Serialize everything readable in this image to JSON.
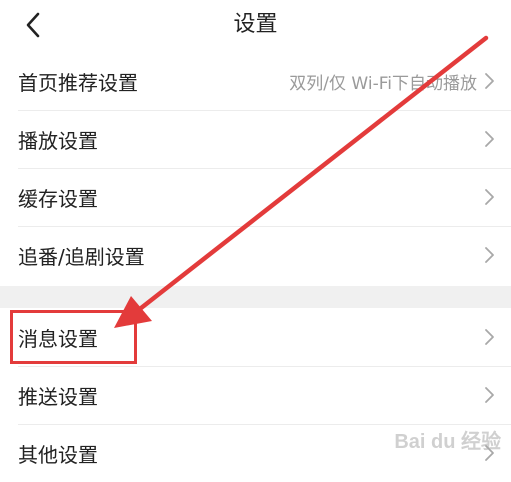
{
  "header": {
    "title": "设置",
    "back_icon": "chevron-left-icon"
  },
  "settings": [
    {
      "label": "首页推荐设置",
      "value": "双列/仅 Wi-Fi下自动播放"
    },
    {
      "label": "播放设置"
    },
    {
      "label": "缓存设置"
    },
    {
      "label": "追番/追剧设置"
    }
  ],
  "settings2": [
    {
      "label": "消息设置",
      "highlighted": true
    },
    {
      "label": "推送设置"
    },
    {
      "label": "其他设置"
    }
  ],
  "annotation": {
    "color": "#e33b3b",
    "arrow_target": "消息设置"
  },
  "watermark": "Bai du 经验",
  "colors": {
    "background": "#ffffff",
    "divider_band": "#f0f0f0",
    "secondary_text": "#9a9a9a",
    "annotation": "#e33b3b"
  }
}
